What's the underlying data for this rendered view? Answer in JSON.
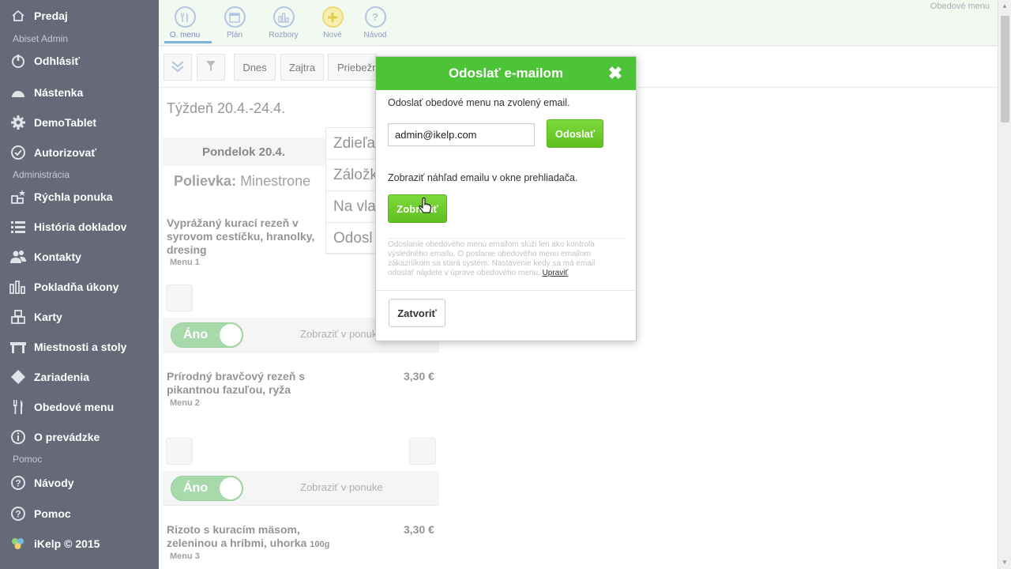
{
  "sidebar": {
    "items": [
      {
        "label": "Predaj",
        "icon": "home-icon"
      },
      {
        "section": "Abiset Admin"
      },
      {
        "label": "Odhlásiť",
        "icon": "power-icon"
      },
      {
        "label": "Nástenka",
        "icon": "dashboard-icon"
      },
      {
        "label": "DemoTablet",
        "icon": "gear-icon"
      },
      {
        "label": "Autorizovať",
        "icon": "check-circle-icon"
      },
      {
        "section": "Administrácia"
      },
      {
        "label": "Rýchla ponuka",
        "icon": "quick-menu-icon"
      },
      {
        "label": "História dokladov",
        "icon": "list-icon"
      },
      {
        "label": "Kontakty",
        "icon": "users-icon"
      },
      {
        "label": "Pokladňa úkony",
        "icon": "bar-chart-icon"
      },
      {
        "label": "Karty",
        "icon": "cards-icon"
      },
      {
        "label": "Miestnosti a stoly",
        "icon": "table-icon"
      },
      {
        "label": "Zariadenia",
        "icon": "diamond-icon"
      },
      {
        "label": "Obedové menu",
        "icon": "cutlery-icon"
      },
      {
        "label": "O prevádzke",
        "icon": "info-icon"
      },
      {
        "section": "Pomoc"
      },
      {
        "label": "Návody",
        "icon": "help-icon"
      },
      {
        "label": "Pomoc",
        "icon": "help-icon"
      },
      {
        "label": "iKelp © 2015",
        "icon": "ikelp-logo-icon"
      }
    ]
  },
  "topbar": {
    "tools": [
      {
        "label": "O. menu",
        "icon": "cutlery-icon"
      },
      {
        "label": "Plán",
        "icon": "calendar-icon"
      },
      {
        "label": "Rozbory",
        "icon": "chart-icon"
      },
      {
        "label": "Nové",
        "icon": "plus-icon"
      },
      {
        "label": "Návod",
        "icon": "help-icon"
      }
    ],
    "right_label": "Obedové menu"
  },
  "filters": {
    "today": "Dnes",
    "tomorrow": "Zajtra",
    "ongoing": "Priebežn"
  },
  "content": {
    "week": "Týždeň 20.4.-24.4.",
    "day": "Pondelok 20.4.",
    "soup_label": "Polievka:",
    "soup_name": "Minestrone",
    "context_menu": [
      "Zdieľa",
      "Záložk",
      "Na vla",
      "Odosl"
    ],
    "dishes": [
      {
        "name": "Vyprážaný kurací rezeň v syrovom cestíčku, hranolky, dresing",
        "menu": "Menu 1",
        "price": ""
      },
      {
        "name": "Prírodný bravčový rezeň s pikantnou fazuľou, ryža",
        "menu": "Menu 2",
        "price": "3,30 €"
      },
      {
        "name": "Rizoto s kuracím mäsom, zeleninou a hríbmi, uhorka",
        "weight": "100g",
        "menu": "Menu 3",
        "price": "3,30 €"
      }
    ],
    "toggle_label": "Áno",
    "show_in_menu": "Zobraziť v ponuke"
  },
  "modal": {
    "title": "Odoslať e-mailom",
    "desc": "Odoslať obedové menu na zvolený email.",
    "email_value": "admin@ikelp.com",
    "send_label": "Odoslať",
    "preview_text": "Zobraziť náhľad emailu v okne prehliadača.",
    "show_label": "Zobraziť",
    "note": "Odoslanie obedového menu emailom slúži len ako kontrola výsledného emailu. O poslanie obedového menu emailom zákazníkom sa stará systém. Nastavenie kedy sa má email odoslať nájdete v úprave obedového menu.",
    "edit_link": "Upraviť",
    "close_label": "Zatvoriť"
  }
}
